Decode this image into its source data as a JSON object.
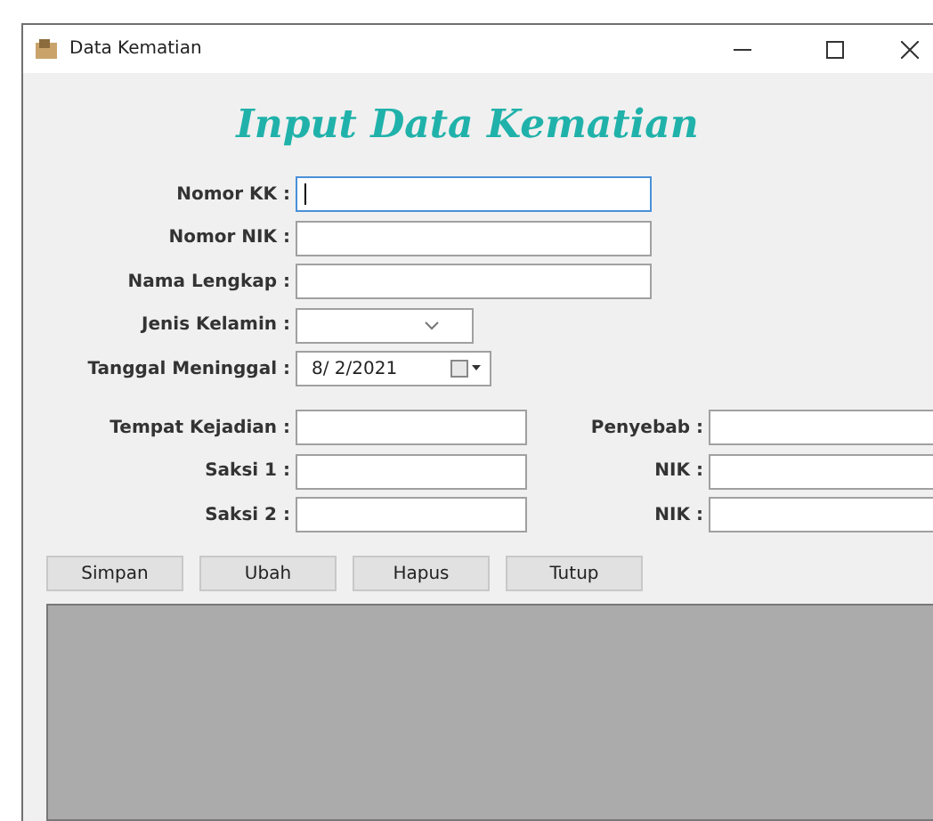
{
  "window": {
    "title": "Data Kematian"
  },
  "heading": "Input Data Kematian",
  "fields": [
    {
      "label": "Nomor KK :",
      "kind": "text",
      "focused": true
    },
    {
      "label": "Nomor NIK :",
      "kind": "text",
      "focused": false
    },
    {
      "label": "Nama Lengkap :",
      "kind": "text",
      "focused": false
    },
    {
      "label": "Jenis Kelamin :",
      "kind": "combo",
      "focused": false
    },
    {
      "label": "Tanggal Meninggal :",
      "kind": "date",
      "value": "8/ 2/2021",
      "focused": false
    },
    {
      "label": "Tempat Kejadian :",
      "kind": "short",
      "focused": false,
      "right": {
        "label": "Penyebab :"
      }
    },
    {
      "label": "Saksi 1 :",
      "kind": "short",
      "focused": false,
      "right": {
        "label": "NIK :"
      }
    },
    {
      "label": "Saksi 2 :",
      "kind": "short",
      "focused": false,
      "right": {
        "label": "NIK :"
      }
    }
  ],
  "buttons": [
    "Simpan",
    "Ubah",
    "Hapus",
    "Tutup"
  ]
}
